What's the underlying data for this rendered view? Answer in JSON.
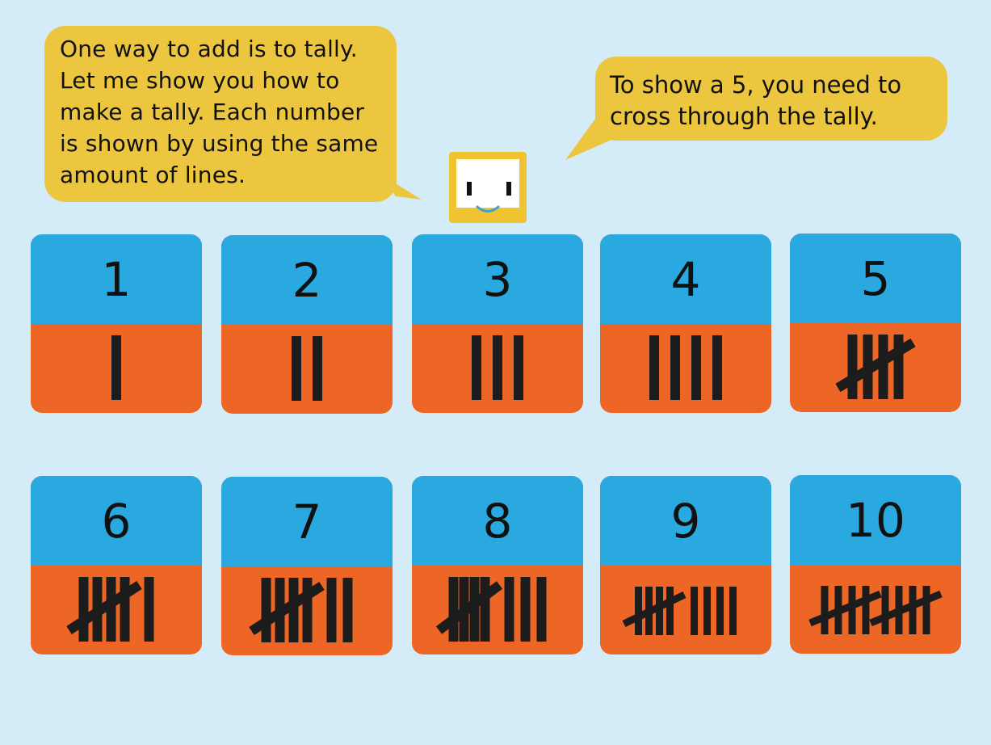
{
  "bubbles": {
    "left": "One way to add is to tally. Let me show you how to make a tally. Each number is shown by using the same amount of lines.",
    "right": "To show a 5, you need to cross through the tally."
  },
  "cards": [
    {
      "number": "1",
      "tally": 1
    },
    {
      "number": "2",
      "tally": 2
    },
    {
      "number": "3",
      "tally": 3
    },
    {
      "number": "4",
      "tally": 4
    },
    {
      "number": "5",
      "tally": 5
    },
    {
      "number": "6",
      "tally": 6
    },
    {
      "number": "7",
      "tally": 7
    },
    {
      "number": "8",
      "tally": 8
    },
    {
      "number": "9",
      "tally": 9
    },
    {
      "number": "10",
      "tally": 10
    }
  ],
  "colors": {
    "background": "#d4ecf7",
    "bubble": "#ecc63f",
    "card_top": "#2aa8e0",
    "card_bottom": "#ee6625",
    "robot": "#f0c431"
  }
}
